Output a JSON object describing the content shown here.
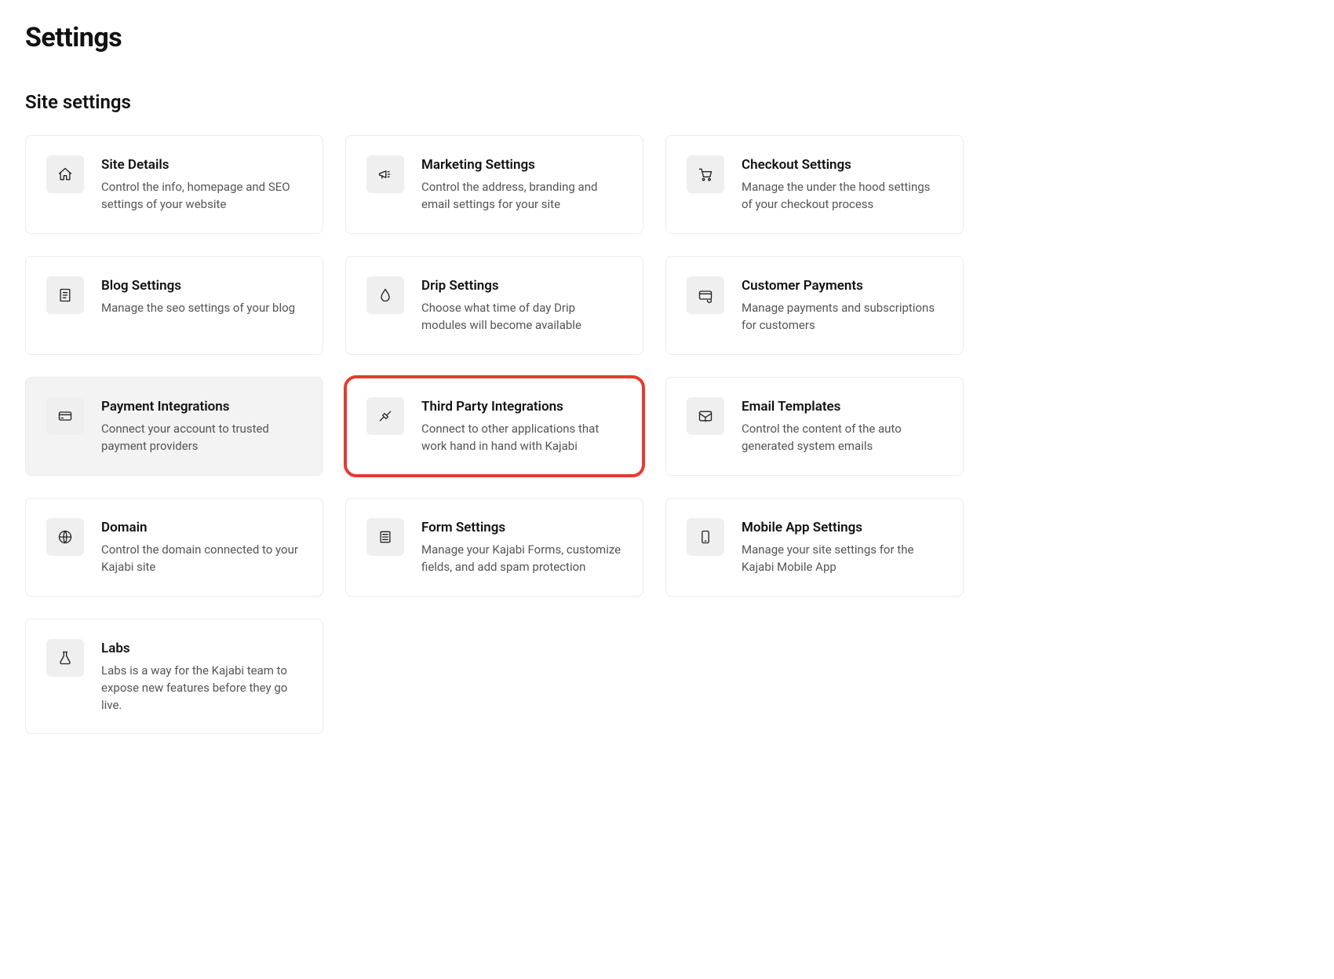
{
  "page_title": "Settings",
  "section_title": "Site settings",
  "cards": [
    {
      "icon": "home",
      "title": "Site Details",
      "desc": "Control the info, homepage and SEO settings of your website",
      "hovered": false,
      "highlighted": false
    },
    {
      "icon": "megaphone",
      "title": "Marketing Settings",
      "desc": "Control the address, branding and email settings for your site",
      "hovered": false,
      "highlighted": false
    },
    {
      "icon": "cart",
      "title": "Checkout Settings",
      "desc": "Manage the under the hood settings of your checkout process",
      "hovered": false,
      "highlighted": false
    },
    {
      "icon": "blog",
      "title": "Blog Settings",
      "desc": "Manage the seo settings of your blog",
      "hovered": false,
      "highlighted": false
    },
    {
      "icon": "drip",
      "title": "Drip Settings",
      "desc": "Choose what time of day Drip modules will become available",
      "hovered": false,
      "highlighted": false
    },
    {
      "icon": "card-sync",
      "title": "Customer Payments",
      "desc": "Manage payments and subscriptions for customers",
      "hovered": false,
      "highlighted": false
    },
    {
      "icon": "credit-card",
      "title": "Payment Integrations",
      "desc": "Connect your account to trusted payment providers",
      "hovered": true,
      "highlighted": false
    },
    {
      "icon": "plug",
      "title": "Third Party Integrations",
      "desc": "Connect to other applications that work hand in hand with Kajabi",
      "hovered": false,
      "highlighted": true
    },
    {
      "icon": "email-template",
      "title": "Email Templates",
      "desc": "Control the content of the auto generated system emails",
      "hovered": false,
      "highlighted": false
    },
    {
      "icon": "globe",
      "title": "Domain",
      "desc": "Control the domain connected to your Kajabi site",
      "hovered": false,
      "highlighted": false
    },
    {
      "icon": "form",
      "title": "Form Settings",
      "desc": "Manage your Kajabi Forms, customize fields, and add spam protection",
      "hovered": false,
      "highlighted": false
    },
    {
      "icon": "mobile",
      "title": "Mobile App Settings",
      "desc": "Manage your site settings for the Kajabi Mobile App",
      "hovered": false,
      "highlighted": false
    },
    {
      "icon": "flask",
      "title": "Labs",
      "desc": "Labs is a way for the Kajabi team to expose new features before they go live.",
      "hovered": false,
      "highlighted": false
    }
  ]
}
